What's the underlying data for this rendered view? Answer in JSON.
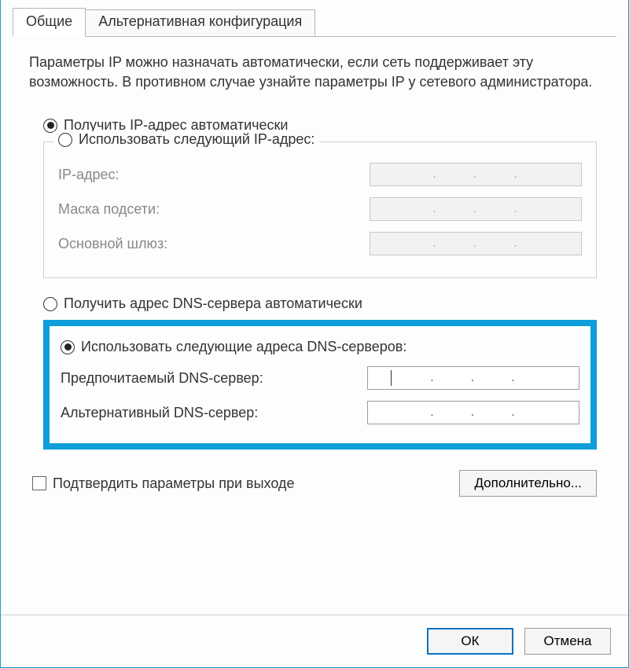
{
  "tabs": {
    "general": "Общие",
    "alternate": "Альтернативная конфигурация"
  },
  "description": "Параметры IP можно назначать автоматически, если сеть поддерживает эту возможность. В противном случае узнайте параметры IP у сетевого администратора.",
  "ip": {
    "auto_radio": "Получить IP-адрес автоматически",
    "manual_radio": "Использовать следующий IP-адрес:",
    "address_label": "IP-адрес:",
    "mask_label": "Маска подсети:",
    "gateway_label": "Основной шлюз:",
    "dots": ".       .       ."
  },
  "dns": {
    "auto_radio": "Получить адрес DNS-сервера автоматически",
    "manual_radio": "Использовать следующие адреса DNS-серверов:",
    "preferred_label": "Предпочитаемый DNS-сервер:",
    "alternate_label": "Альтернативный DNS-сервер:",
    "dots": ".       .       ."
  },
  "validate_checkbox": "Подтвердить параметры при выходе",
  "advanced_button": "Дополнительно...",
  "ok_button": "ОК",
  "cancel_button": "Отмена"
}
